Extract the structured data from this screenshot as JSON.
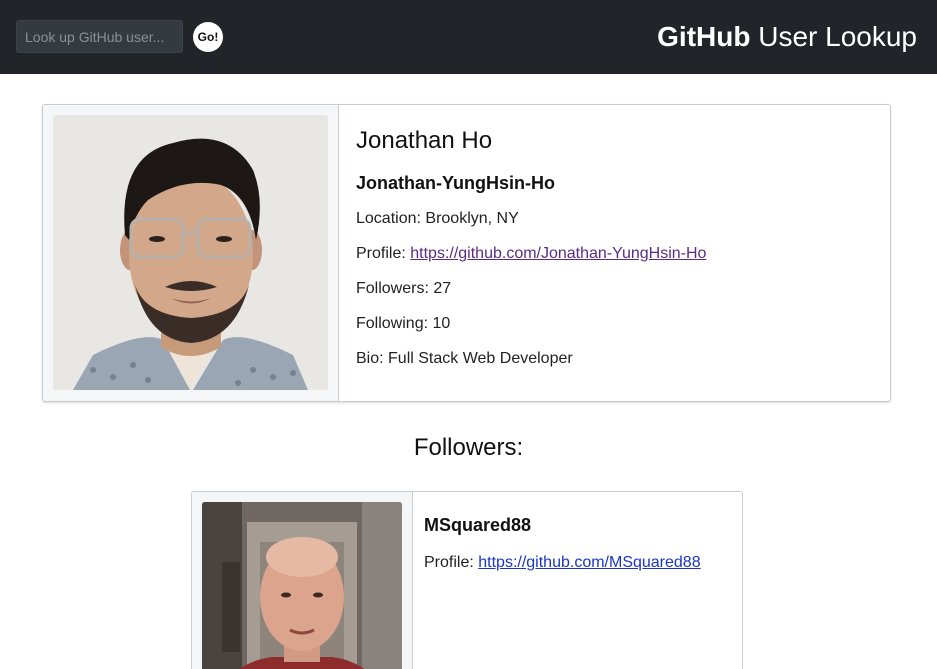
{
  "nav": {
    "search_placeholder": "Look up GitHub user...",
    "go_label": "Go!",
    "brand_bold": "GitHub",
    "brand_rest": " User Lookup"
  },
  "user": {
    "name": "Jonathan Ho",
    "login": "Jonathan-YungHsin-Ho",
    "location_label": "Location: ",
    "location": "Brooklyn, NY",
    "profile_label": "Profile: ",
    "profile_url": "https://github.com/Jonathan-YungHsin-Ho",
    "followers_label": "Followers: ",
    "followers": "27",
    "following_label": "Following: ",
    "following": "10",
    "bio_label": "Bio: ",
    "bio": "Full Stack Web Developer"
  },
  "followers_section": {
    "title": "Followers:",
    "items": [
      {
        "login": "MSquared88",
        "profile_label": "Profile: ",
        "profile_url": "https://github.com/MSquared88"
      }
    ]
  },
  "colors": {
    "navbar": "#212529",
    "link_visited": "#5a2c84",
    "link": "#1a34c6"
  }
}
